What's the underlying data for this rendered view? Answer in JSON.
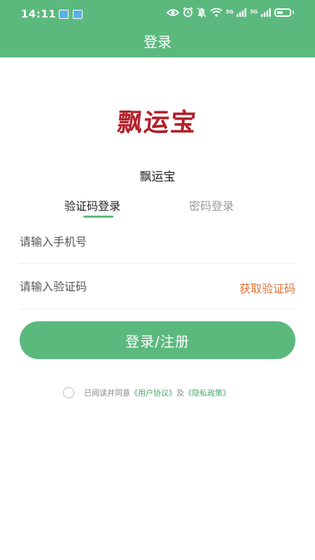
{
  "status_bar": {
    "time": "14:11",
    "net1": "5G",
    "net2": "5G",
    "icons": [
      "app-notification-icon",
      "app-notification-icon",
      "eye-icon",
      "alarm-icon",
      "mute-bell-icon",
      "wifi-icon",
      "signal-icon",
      "signal-icon",
      "battery-icon"
    ]
  },
  "header": {
    "title": "登录"
  },
  "logo": {
    "text": "飘运宝"
  },
  "app_name": "飘运宝",
  "tabs": {
    "active": "验证码登录",
    "inactive": "密码登录"
  },
  "form": {
    "phone_placeholder": "请输入手机号",
    "code_placeholder": "请输入验证码",
    "get_code": "获取验证码"
  },
  "login_button": "登录/注册",
  "agreement": {
    "prefix": "已阅读并同意",
    "user_agreement": "《用户协议》",
    "and": "及",
    "privacy_policy": "《隐私政策》"
  },
  "colors": {
    "primary": "#5cb97e",
    "accent_orange": "#e07038",
    "logo_red": "#b3202a"
  }
}
